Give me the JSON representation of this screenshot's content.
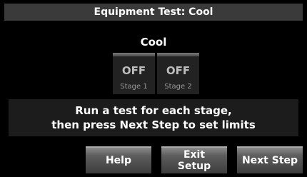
{
  "header": {
    "title": "Equipment Test: Cool"
  },
  "mode": {
    "label": "Cool"
  },
  "stages": [
    {
      "state": "OFF",
      "name": "Stage 1"
    },
    {
      "state": "OFF",
      "name": "Stage 2"
    }
  ],
  "message": {
    "line1": "Run a test for each stage,",
    "line2": "then press Next Step to set limits"
  },
  "buttons": {
    "help": "Help",
    "exit_line1": "Exit",
    "exit_line2": "Setup",
    "next": "Next Step"
  }
}
